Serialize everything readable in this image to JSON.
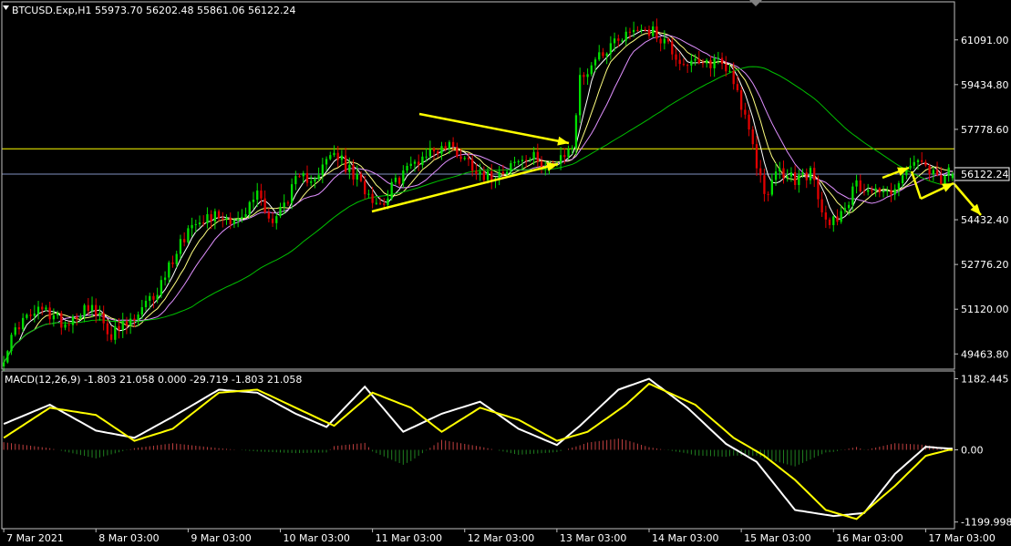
{
  "header": {
    "symbol_info": "BTCUSD.Exp,H1  55973.70 56202.48 55861.06 56122.24",
    "macd_info": "MACD(12,26,9) -1.803 21.058 0.000 -29.719 -1.803 21.058"
  },
  "colors": {
    "background": "#000000",
    "bull_candle": "#00e000",
    "bear_candle": "#e00000",
    "ma_white": "#ffffff",
    "ma_yellow": "#ffff80",
    "ma_pink": "#e090ff",
    "ma_green": "#00c000",
    "hline_yellow": "#ffff00",
    "hline_price": "#8090c0",
    "macd_main": "#ffffff",
    "macd_signal": "#ffff00",
    "hist_pos": "#c04040",
    "hist_neg": "#208020",
    "arrow": "#ffff00",
    "frame": "#c0c0c0"
  },
  "chart_data": [
    {
      "type": "candlestick",
      "title": "BTCUSD.Exp,H1",
      "ohlc_last": {
        "open": 55973.7,
        "high": 56202.48,
        "low": 55861.06,
        "close": 56122.24
      },
      "current_price": 56122.24,
      "current_price_label": "56122.24",
      "ylim": [
        48900,
        62500
      ],
      "y_ticks": [
        {
          "value": 61091.0,
          "label": "61091.00"
        },
        {
          "value": 59434.8,
          "label": "59434.80"
        },
        {
          "value": 57778.6,
          "label": "57778.60"
        },
        {
          "value": 54432.4,
          "label": "54432.40"
        },
        {
          "value": 52776.2,
          "label": "52776.20"
        },
        {
          "value": 51120.0,
          "label": "51120.00"
        },
        {
          "value": 49463.8,
          "label": "49463.80"
        }
      ],
      "horizontal_lines": [
        {
          "value": 57060,
          "color": "yellow"
        }
      ],
      "x_ticks": [
        {
          "index": 0,
          "label": "7 Mar 2021"
        },
        {
          "index": 24,
          "label": "8 Mar 03:00"
        },
        {
          "index": 48,
          "label": "9 Mar 03:00"
        },
        {
          "index": 72,
          "label": "10 Mar 03:00"
        },
        {
          "index": 96,
          "label": "11 Mar 03:00"
        },
        {
          "index": 120,
          "label": "12 Mar 03:00"
        },
        {
          "index": 144,
          "label": "13 Mar 03:00"
        },
        {
          "index": 168,
          "label": "14 Mar 03:00"
        },
        {
          "index": 192,
          "label": "15 Mar 03:00"
        },
        {
          "index": 216,
          "label": "16 Mar 03:00"
        },
        {
          "index": 240,
          "label": "17 Mar 03:00"
        }
      ],
      "close_keypoints": [
        [
          0,
          49400
        ],
        [
          4,
          50600
        ],
        [
          10,
          51100
        ],
        [
          16,
          50600
        ],
        [
          22,
          51300
        ],
        [
          28,
          50200
        ],
        [
          34,
          50700
        ],
        [
          40,
          51800
        ],
        [
          46,
          53600
        ],
        [
          50,
          54500
        ],
        [
          56,
          54600
        ],
        [
          62,
          54400
        ],
        [
          66,
          55500
        ],
        [
          70,
          54300
        ],
        [
          76,
          55800
        ],
        [
          82,
          56200
        ],
        [
          86,
          56900
        ],
        [
          92,
          55900
        ],
        [
          98,
          55000
        ],
        [
          104,
          56200
        ],
        [
          110,
          56900
        ],
        [
          116,
          57200
        ],
        [
          120,
          56700
        ],
        [
          126,
          56000
        ],
        [
          132,
          56500
        ],
        [
          138,
          56700
        ],
        [
          144,
          56400
        ],
        [
          148,
          57200
        ],
        [
          150,
          59600
        ],
        [
          154,
          60400
        ],
        [
          160,
          61200
        ],
        [
          166,
          61600
        ],
        [
          172,
          61100
        ],
        [
          176,
          60300
        ],
        [
          182,
          60100
        ],
        [
          186,
          60400
        ],
        [
          190,
          59700
        ],
        [
          194,
          57600
        ],
        [
          198,
          55400
        ],
        [
          202,
          56200
        ],
        [
          206,
          55900
        ],
        [
          210,
          56200
        ],
        [
          212,
          55200
        ],
        [
          214,
          54300
        ],
        [
          218,
          54700
        ],
        [
          222,
          55700
        ],
        [
          226,
          55600
        ],
        [
          230,
          55400
        ],
        [
          234,
          56000
        ],
        [
          238,
          56700
        ],
        [
          240,
          56200
        ],
        [
          244,
          55900
        ],
        [
          246,
          56122
        ]
      ]
    },
    {
      "type": "line",
      "title": "MACD(12,26,9)",
      "values_header": [
        -1.803,
        21.058,
        0.0,
        -29.719,
        -1.803,
        21.058
      ],
      "ylim": [
        -1250,
        1250
      ],
      "y_ticks": [
        {
          "value": 1182.445,
          "label": "1182.445"
        },
        {
          "value": 0.0,
          "label": "0.00"
        },
        {
          "value": -1199.998,
          "label": "-1199.998"
        }
      ],
      "main_keypoints": [
        [
          0,
          430
        ],
        [
          12,
          750
        ],
        [
          24,
          320
        ],
        [
          34,
          200
        ],
        [
          44,
          550
        ],
        [
          56,
          1000
        ],
        [
          66,
          950
        ],
        [
          76,
          600
        ],
        [
          84,
          380
        ],
        [
          94,
          1050
        ],
        [
          104,
          300
        ],
        [
          114,
          600
        ],
        [
          124,
          800
        ],
        [
          134,
          350
        ],
        [
          144,
          80
        ],
        [
          150,
          400
        ],
        [
          160,
          1000
        ],
        [
          168,
          1180
        ],
        [
          178,
          700
        ],
        [
          188,
          100
        ],
        [
          196,
          -200
        ],
        [
          206,
          -1000
        ],
        [
          216,
          -1100
        ],
        [
          224,
          -1050
        ],
        [
          232,
          -400
        ],
        [
          240,
          50
        ],
        [
          246,
          21
        ]
      ],
      "signal_keypoints": [
        [
          0,
          200
        ],
        [
          12,
          700
        ],
        [
          24,
          580
        ],
        [
          34,
          150
        ],
        [
          44,
          350
        ],
        [
          56,
          950
        ],
        [
          66,
          1000
        ],
        [
          76,
          700
        ],
        [
          86,
          400
        ],
        [
          96,
          950
        ],
        [
          106,
          700
        ],
        [
          114,
          300
        ],
        [
          124,
          700
        ],
        [
          134,
          500
        ],
        [
          144,
          150
        ],
        [
          152,
          300
        ],
        [
          162,
          750
        ],
        [
          168,
          1100
        ],
        [
          180,
          750
        ],
        [
          190,
          200
        ],
        [
          198,
          -100
        ],
        [
          206,
          -500
        ],
        [
          214,
          -1000
        ],
        [
          222,
          -1150
        ],
        [
          232,
          -600
        ],
        [
          240,
          -100
        ],
        [
          246,
          -2
        ]
      ]
    }
  ]
}
